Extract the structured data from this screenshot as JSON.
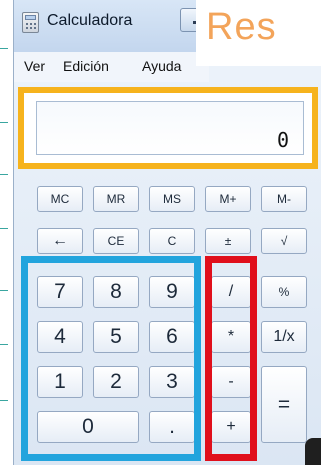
{
  "window": {
    "title": "Calculadora",
    "overlay_text": "Res"
  },
  "menu": {
    "items": [
      "Ver",
      "Edición",
      "Ayuda"
    ]
  },
  "display": {
    "value": "0"
  },
  "memory_row": [
    "MC",
    "MR",
    "MS",
    "M+",
    "M-"
  ],
  "edit_row": [
    "←",
    "CE",
    "C",
    "±",
    "√"
  ],
  "digits": {
    "d7": "7",
    "d8": "8",
    "d9": "9",
    "d4": "4",
    "d5": "5",
    "d6": "6",
    "d1": "1",
    "d2": "2",
    "d3": "3",
    "d0": "0",
    "decimal": "."
  },
  "operators": {
    "divide": "/",
    "multiply": "*",
    "subtract": "-",
    "add": "+"
  },
  "extras": {
    "percent": "%",
    "reciprocal": "1/x",
    "equals": "="
  },
  "highlight_colors": {
    "display_frame": "#f6b31d",
    "digits_frame": "#22a4dd",
    "operators_frame": "#e00f1b"
  }
}
